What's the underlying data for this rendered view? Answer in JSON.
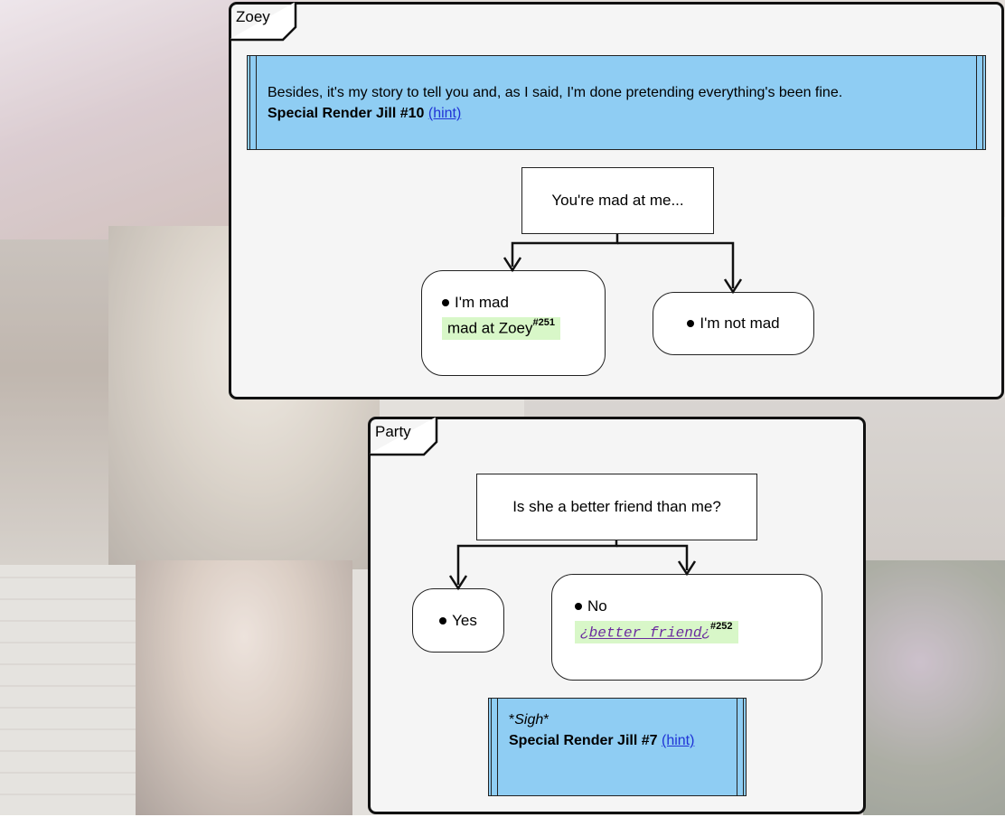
{
  "zoey": {
    "tab": "Zoey",
    "note_text": "Besides, it's my story to tell you and, as I said, I'm done pretending everything's been fine.",
    "note_bold": "Special Render Jill #10",
    "note_hint": "(hint)",
    "question": "You're mad at me...",
    "choice_mad": {
      "label": "I'm mad",
      "effect": "mad at Zoey",
      "ref": "#251"
    },
    "choice_not_mad": {
      "label": "I'm not mad"
    }
  },
  "party": {
    "tab": "Party",
    "question": "Is she a better friend than me?",
    "choice_yes": {
      "label": "Yes"
    },
    "choice_no": {
      "label": "No",
      "effect_left": "¿",
      "effect_link": "better friend",
      "effect_right": "¿",
      "ref": "#252"
    },
    "note_italic": "Sigh",
    "note_star": "*",
    "note_bold": "Special Render Jill #7",
    "note_hint": "(hint)"
  },
  "colors": {
    "frame_bg": "#f5f5f5",
    "note_bg": "#8fcdf3",
    "effect_bg": "#d8f7c8",
    "hint_link": "#1f33d6",
    "var_link": "#6a2a9e"
  }
}
